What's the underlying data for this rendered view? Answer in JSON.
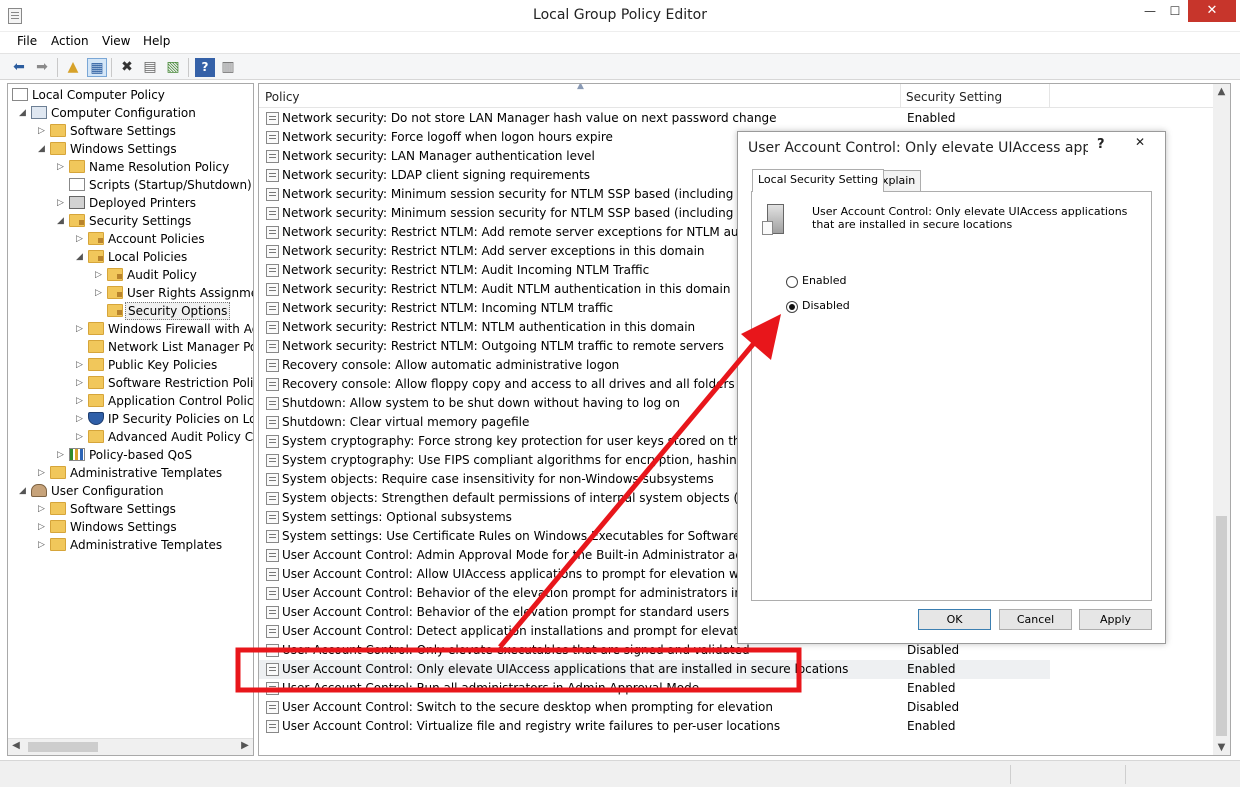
{
  "window": {
    "title": "Local Group Policy Editor",
    "minimize_glyph": "—",
    "maximize_glyph": "☐",
    "close_glyph": "✕"
  },
  "menu": [
    "File",
    "Action",
    "View",
    "Help"
  ],
  "toolbar": {
    "buttons": [
      "back-icon",
      "forward-icon",
      "up-folder-icon",
      "show-hide-tree-icon",
      "delete-icon",
      "properties-icon",
      "export-list-icon",
      "help-icon",
      "extended-view-icon"
    ]
  },
  "tree": [
    {
      "label": "Local Computer Policy",
      "icon": "doc",
      "level": 0,
      "arrow": ""
    },
    {
      "label": "Computer Configuration",
      "icon": "computer",
      "level": 1,
      "arrow": "◢"
    },
    {
      "label": "Software Settings",
      "icon": "folder",
      "level": 2,
      "arrow": "▷"
    },
    {
      "label": "Windows Settings",
      "icon": "folder",
      "level": 2,
      "arrow": "◢"
    },
    {
      "label": "Name Resolution Policy",
      "icon": "folder",
      "level": 3,
      "arrow": "▷"
    },
    {
      "label": "Scripts (Startup/Shutdown)",
      "icon": "doc",
      "level": 3,
      "arrow": ""
    },
    {
      "label": "Deployed Printers",
      "icon": "printer",
      "level": 3,
      "arrow": "▷"
    },
    {
      "label": "Security Settings",
      "icon": "folder-lock",
      "level": 3,
      "arrow": "◢"
    },
    {
      "label": "Account Policies",
      "icon": "folder-lock",
      "level": 4,
      "arrow": "▷"
    },
    {
      "label": "Local Policies",
      "icon": "folder-lock",
      "level": 4,
      "arrow": "◢"
    },
    {
      "label": "Audit Policy",
      "icon": "folder-lock",
      "level": 5,
      "arrow": "▷"
    },
    {
      "label": "User Rights Assignment",
      "icon": "folder-lock",
      "level": 5,
      "arrow": "▷"
    },
    {
      "label": "Security Options",
      "icon": "folder-lock",
      "level": 5,
      "arrow": "",
      "selected": true
    },
    {
      "label": "Windows Firewall with Adv",
      "icon": "folder",
      "level": 4,
      "arrow": "▷"
    },
    {
      "label": "Network List Manager Polic",
      "icon": "folder",
      "level": 4,
      "arrow": ""
    },
    {
      "label": "Public Key Policies",
      "icon": "folder",
      "level": 4,
      "arrow": "▷"
    },
    {
      "label": "Software Restriction Policie",
      "icon": "folder",
      "level": 4,
      "arrow": "▷"
    },
    {
      "label": "Application Control Policie",
      "icon": "folder",
      "level": 4,
      "arrow": "▷"
    },
    {
      "label": "IP Security Policies on Loca",
      "icon": "shield",
      "level": 4,
      "arrow": "▷"
    },
    {
      "label": "Advanced Audit Policy Cor",
      "icon": "folder",
      "level": 4,
      "arrow": "▷"
    },
    {
      "label": "Policy-based QoS",
      "icon": "chart",
      "level": 3,
      "arrow": "▷"
    },
    {
      "label": "Administrative Templates",
      "icon": "folder",
      "level": 2,
      "arrow": "▷"
    },
    {
      "label": "User Configuration",
      "icon": "user",
      "level": 1,
      "arrow": "◢"
    },
    {
      "label": "Software Settings",
      "icon": "folder",
      "level": 2,
      "arrow": "▷"
    },
    {
      "label": "Windows Settings",
      "icon": "folder",
      "level": 2,
      "arrow": "▷"
    },
    {
      "label": "Administrative Templates",
      "icon": "folder",
      "level": 2,
      "arrow": "▷"
    }
  ],
  "list": {
    "col_policy": "Policy",
    "col_setting": "Security Setting",
    "rows": [
      {
        "policy": "Network security: Do not store LAN Manager hash value on next password change",
        "setting": "Enabled"
      },
      {
        "policy": "Network security: Force logoff when logon hours expire",
        "setting": ""
      },
      {
        "policy": "Network security: LAN Manager authentication level",
        "setting": ""
      },
      {
        "policy": "Network security: LDAP client signing requirements",
        "setting": ""
      },
      {
        "policy": "Network security: Minimum session security for NTLM SSP based (including secure RPC",
        "setting": ""
      },
      {
        "policy": "Network security: Minimum session security for NTLM SSP based (including secure RPC",
        "setting": ""
      },
      {
        "policy": "Network security: Restrict NTLM: Add remote server exceptions for NTLM authenticatio",
        "setting": ""
      },
      {
        "policy": "Network security: Restrict NTLM: Add server exceptions in this domain",
        "setting": ""
      },
      {
        "policy": "Network security: Restrict NTLM: Audit Incoming NTLM Traffic",
        "setting": ""
      },
      {
        "policy": "Network security: Restrict NTLM: Audit NTLM authentication in this domain",
        "setting": ""
      },
      {
        "policy": "Network security: Restrict NTLM: Incoming NTLM traffic",
        "setting": ""
      },
      {
        "policy": "Network security: Restrict NTLM: NTLM authentication in this domain",
        "setting": ""
      },
      {
        "policy": "Network security: Restrict NTLM: Outgoing NTLM traffic to remote servers",
        "setting": ""
      },
      {
        "policy": "Recovery console: Allow automatic administrative logon",
        "setting": ""
      },
      {
        "policy": "Recovery console: Allow floppy copy and access to all drives and all folders",
        "setting": ""
      },
      {
        "policy": "Shutdown: Allow system to be shut down without having to log on",
        "setting": ""
      },
      {
        "policy": "Shutdown: Clear virtual memory pagefile",
        "setting": ""
      },
      {
        "policy": "System cryptography: Force strong key protection for user keys stored on the compute",
        "setting": ""
      },
      {
        "policy": "System cryptography: Use FIPS compliant algorithms for encryption, hashing, and sign",
        "setting": ""
      },
      {
        "policy": "System objects: Require case insensitivity for non-Windows subsystems",
        "setting": ""
      },
      {
        "policy": "System objects: Strengthen default permissions of internal system objects (e.g. Symbol",
        "setting": ""
      },
      {
        "policy": "System settings: Optional subsystems",
        "setting": ""
      },
      {
        "policy": "System settings: Use Certificate Rules on Windows Executables for Software Restriction",
        "setting": ""
      },
      {
        "policy": "User Account Control: Admin Approval Mode for the Built-in Administrator account",
        "setting": ""
      },
      {
        "policy": "User Account Control: Allow UIAccess applications to prompt for elevation without usi",
        "setting": ""
      },
      {
        "policy": "User Account Control: Behavior of the elevation prompt for administrators in Admin Ap",
        "setting": ""
      },
      {
        "policy": "User Account Control: Behavior of the elevation prompt for standard users",
        "setting": ""
      },
      {
        "policy": "User Account Control: Detect application installations and prompt for elevation",
        "setting": ""
      },
      {
        "policy": "User Account Control: Only elevate executables that are signed and validated",
        "setting": "Disabled"
      },
      {
        "policy": "User Account Control: Only elevate UIAccess applications that are installed in secure locations",
        "setting": "Enabled",
        "highlight": true
      },
      {
        "policy": "User Account Control: Run all administrators in Admin Approval Mode",
        "setting": "Enabled"
      },
      {
        "policy": "User Account Control: Switch to the secure desktop when prompting for elevation",
        "setting": "Disabled"
      },
      {
        "policy": "User Account Control: Virtualize file and registry write failures to per-user locations",
        "setting": "Enabled"
      }
    ]
  },
  "dialog": {
    "title": "User Account Control: Only elevate UIAccess appli...",
    "help_glyph": "?",
    "close_glyph": "✕",
    "tabs": [
      "Local Security Setting",
      "Explain"
    ],
    "description": "User Account Control: Only elevate UIAccess applications that are installed in secure locations",
    "options": [
      {
        "label": "Enabled",
        "checked": false
      },
      {
        "label": "Disabled",
        "checked": true
      }
    ],
    "buttons": [
      "OK",
      "Cancel",
      "Apply"
    ]
  },
  "annotation_color": "#e8161b"
}
